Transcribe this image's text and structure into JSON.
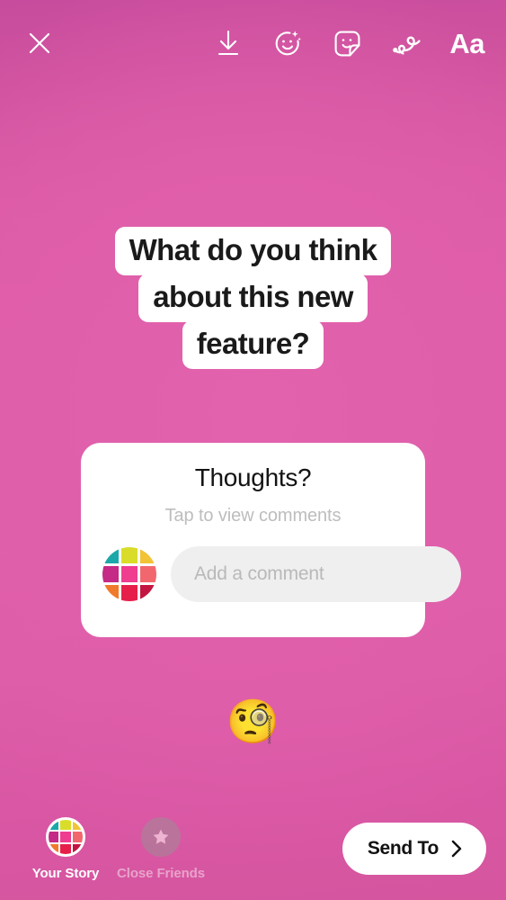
{
  "screen": {
    "name": "instagram-story-composer",
    "background_colors": {
      "top": "#c74c9d",
      "middle": "#e05fab",
      "bottom": "#d6559f"
    }
  },
  "topbar": {
    "close_icon": "close-icon",
    "actions": [
      {
        "icon": "download-icon",
        "label": "Save"
      },
      {
        "icon": "effects-face-sparkle-icon",
        "label": "Effects"
      },
      {
        "icon": "sticker-icon",
        "label": "Stickers"
      },
      {
        "icon": "draw-squiggle-icon",
        "label": "Draw"
      }
    ],
    "text_tool_label": "Aa"
  },
  "headline": {
    "lines": [
      "What do you think",
      "about this new",
      "feature?"
    ],
    "text_color": "#1a1a1a",
    "background_color": "#ffffff"
  },
  "comment_card": {
    "title": "Thoughts?",
    "subtitle": "Tap to view comments",
    "input_placeholder": "Add a comment",
    "input_value": "",
    "avatar_name": "grid-avatar",
    "avatar_colors": [
      "#1aa8a8",
      "#d9dd2a",
      "#f2c335",
      "#c42a86",
      "#ef3d8f",
      "#f2676e",
      "#f07a2c",
      "#e61f4a",
      "#c21540"
    ],
    "card_background": "#ffffff",
    "input_background": "#efeff0"
  },
  "emoji_sticker": {
    "glyph": "🧐",
    "name": "monocle-face-emoji"
  },
  "bottombar": {
    "audiences": [
      {
        "label": "Your Story",
        "icon": "grid-avatar",
        "selected": true
      },
      {
        "label": "Close Friends",
        "icon": "star-icon",
        "selected": false
      }
    ],
    "send_button": {
      "label": "Send To",
      "icon": "chevron-right-icon",
      "background": "#ffffff",
      "text_color": "#121212"
    }
  }
}
